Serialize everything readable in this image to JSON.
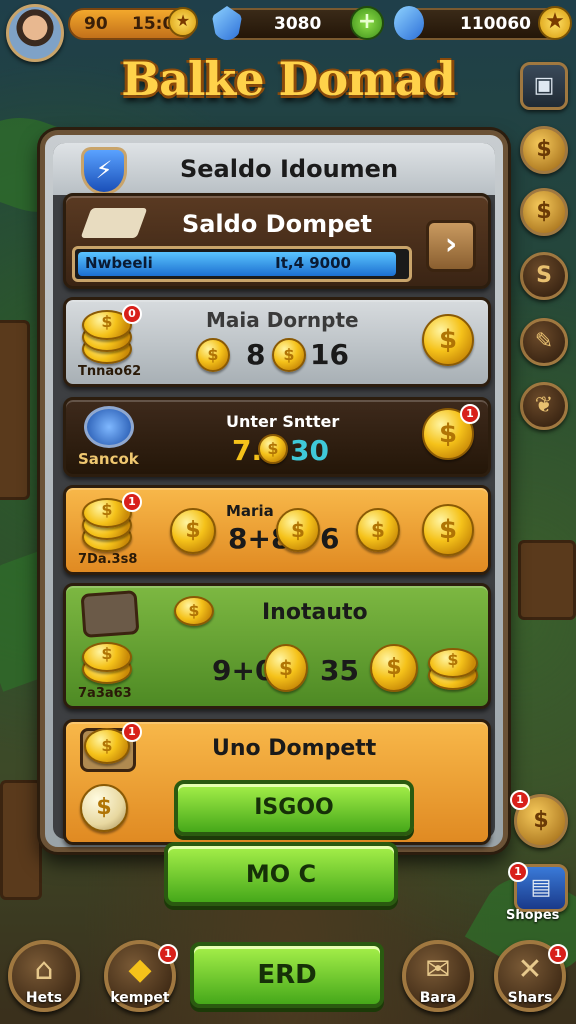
{
  "header": {
    "coin_value": "90",
    "coin_sub": "15:01",
    "gem_value": "3080",
    "star_value": "110060"
  },
  "title": "Balke Domad",
  "panel": {
    "title": "Sealdo Idoumen",
    "wallet_row": {
      "title": "Saldo Dompet",
      "progress_left": "Nwbeeli",
      "progress_right": "It,4 9000",
      "progress_fraction": 0.97
    },
    "row_main": {
      "title": "Maia Dornpte",
      "amount_a": "8",
      "amount_b": "16",
      "stack_label": "Tnnao62"
    },
    "row_counter": {
      "title": "Unter Sntter",
      "amount": "7.",
      "amount_b": "30",
      "badge_label": "Sancok"
    },
    "row_orange": {
      "title": "Maria",
      "amount_a": "8+8",
      "amount_b": "6",
      "stack_label": "7Da.3s8"
    },
    "row_green": {
      "title": "Inotauto",
      "amount_a": "9+0",
      "amount_b": "35",
      "stack_label": "7a3a63"
    },
    "row_bottom": {
      "title": "Uno Dompett",
      "button": "ISGOO"
    }
  },
  "buttons": {
    "mid": "MO C",
    "end": "ERD"
  },
  "nav": {
    "home": "Hets",
    "kempet": "kempet",
    "bara": "Bara",
    "shars": "Shars",
    "shopes": "Shopes"
  },
  "badges": {
    "count": "1"
  },
  "colors": {
    "accent_gold": "#ffd24a",
    "panel_wood": "#6b5236",
    "row_orange": "#f0a23a",
    "row_green": "#5f9a30",
    "row_dark": "#3a2a1e",
    "button_green": "#7ed23a"
  }
}
